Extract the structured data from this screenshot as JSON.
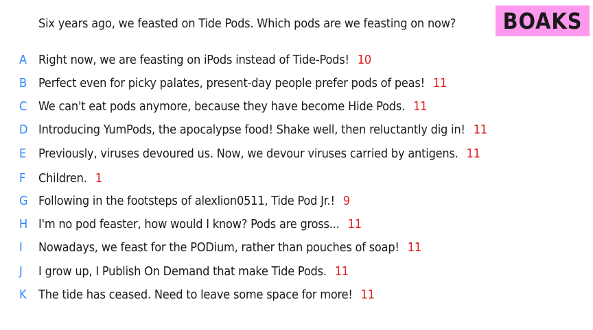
{
  "prompt": "Six years ago, we feasted on Tide Pods. Which pods are we feasting on now?",
  "logo_text": "BOAKS",
  "colors": {
    "letter": "#2f86ff",
    "score": "#e21c1c",
    "badge_bg": "#ff99ee"
  },
  "answers": [
    {
      "letter": "A",
      "text": "Right now, we are feasting on iPods instead of Tide-Pods!",
      "score": "10"
    },
    {
      "letter": "B",
      "text": "Perfect even for picky palates, present-day people prefer pods of peas!",
      "score": "11"
    },
    {
      "letter": "C",
      "text": "We can't eat pods anymore, because they have become Hide Pods.",
      "score": "11"
    },
    {
      "letter": "D",
      "text": "Introducing YumPods, the apocalypse food! Shake well, then reluctantly dig in!",
      "score": "11"
    },
    {
      "letter": "E",
      "text": "Previously, viruses devoured us. Now, we devour viruses carried by antigens.",
      "score": "11"
    },
    {
      "letter": "F",
      "text": "Children.",
      "score": "1"
    },
    {
      "letter": "G",
      "text": "Following in the footsteps of alexlion0511, Tide Pod Jr.!",
      "score": "9"
    },
    {
      "letter": "H",
      "text": "I'm no pod feaster, how would I know? Pods are gross...",
      "score": "11"
    },
    {
      "letter": "I",
      "text": "Nowadays, we feast for the PODium, rather than pouches of soap!",
      "score": "11"
    },
    {
      "letter": "J",
      "text": "I grow up, I Publish On Demand that make Tide Pods.",
      "score": "11"
    },
    {
      "letter": "K",
      "text": "The tide has ceased. Need to leave some space for more!",
      "score": "11"
    }
  ]
}
